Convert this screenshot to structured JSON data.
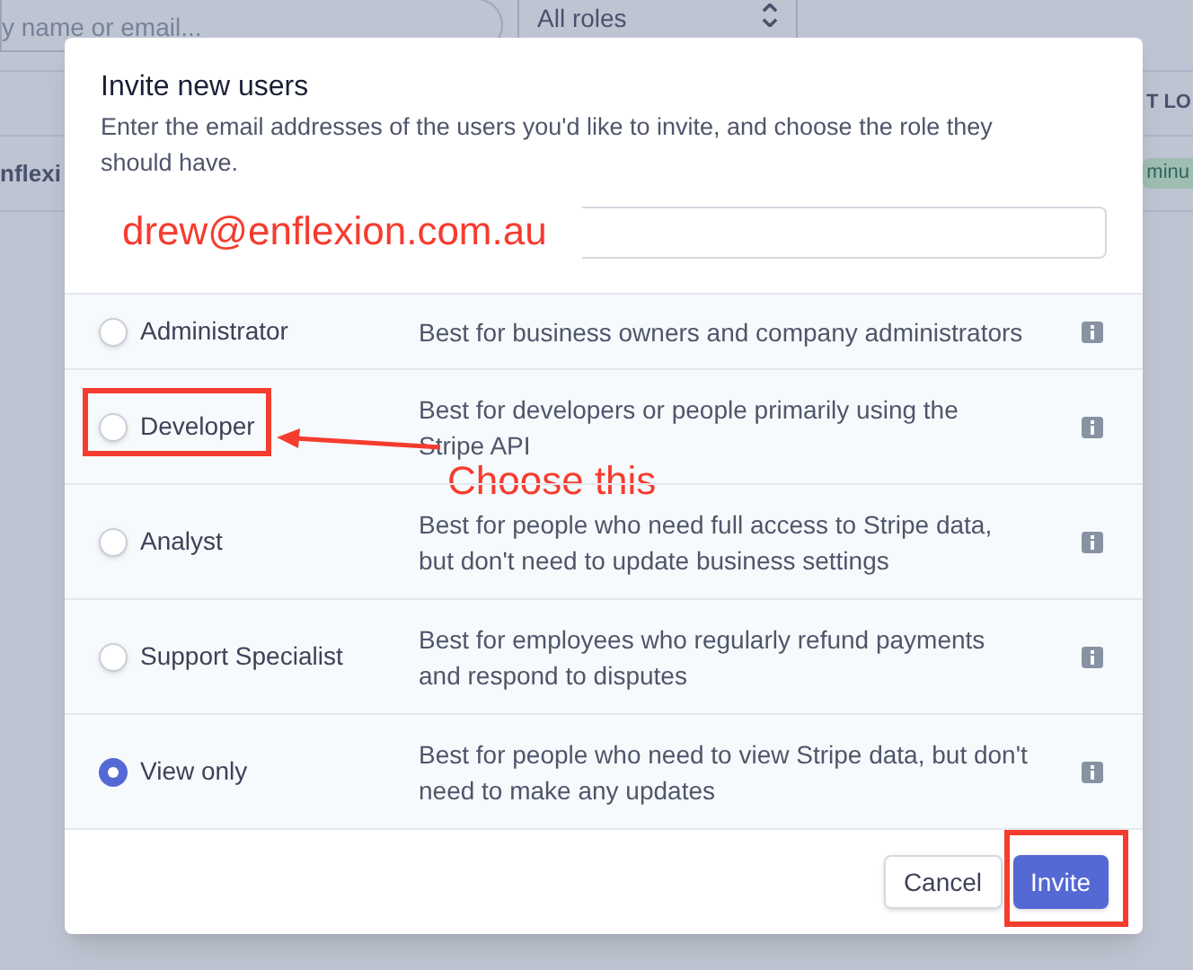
{
  "background": {
    "search": {
      "placeholder": "y name or email..."
    },
    "role_filter": {
      "value": "All roles"
    },
    "column_header": "T LO",
    "row": {
      "name": "nflexi",
      "badge": "minu"
    }
  },
  "dialog": {
    "title": "Invite new users",
    "description": "Enter the email addresses of the users you'd like to invite, and choose the role they should have.",
    "email_field": {
      "annotation": "drew@enflexion.com.au"
    },
    "roles": [
      {
        "label": "Administrator",
        "description": "Best for business owners and company administrators",
        "selected": false,
        "highlighted": false
      },
      {
        "label": "Developer",
        "description": "Best for developers or people primarily using the Stripe API",
        "selected": false,
        "highlighted": true,
        "callout": "Choose this"
      },
      {
        "label": "Analyst",
        "description": "Best for people who need full access to Stripe data, but don't need to update business settings",
        "selected": false,
        "highlighted": false
      },
      {
        "label": "Support Specialist",
        "description": "Best for employees who regularly refund payments and respond to disputes",
        "selected": false,
        "highlighted": false
      },
      {
        "label": "View only",
        "description": "Best for people who need to view Stripe data, but don't need to make any updates",
        "selected": true,
        "highlighted": false
      }
    ],
    "buttons": [
      {
        "label": "Cancel",
        "kind": "secondary",
        "highlighted": false
      },
      {
        "label": "Invite",
        "kind": "primary",
        "highlighted": true
      }
    ]
  }
}
